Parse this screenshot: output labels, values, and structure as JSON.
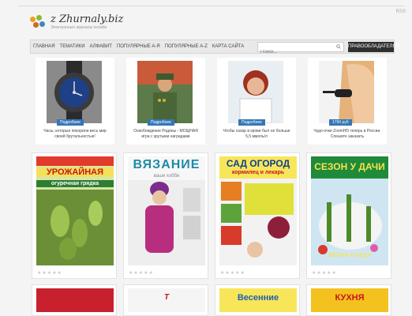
{
  "header": {
    "logo_title": "z Zhurnaly.biz",
    "logo_sub": "Электронные журналы онлайн",
    "corner_text": "RSS"
  },
  "nav": {
    "items": [
      "ГЛАВНАЯ",
      "ТЕМАТИКИ",
      "АЛФАВИТ",
      "ПОПУЛЯРНЫЕ А-Я",
      "ПОПУЛЯРНЫЕ А-Z",
      "КАРТА САЙТА"
    ],
    "search_placeholder": "Поиск...",
    "button_label": "ПРАВООБЛАДАТЕЛЯМ"
  },
  "promos": [
    {
      "tag": "Подробнее",
      "caption": "Часы, которые покорили весь мир своей брутальностью!"
    },
    {
      "tag": "Подробнее",
      "caption": "Освобождение Родины - МОЩНАЯ игра с крутыми наградами"
    },
    {
      "tag": "Подробнее",
      "caption": "Чтобы сахар в крови был не больше 5,5 ммоль/л"
    },
    {
      "tag": "1790 руб",
      "caption": "Чудо-очки ZoomHD теперь в России. Спешите заказать"
    }
  ],
  "magazines": [
    {
      "title": "УРОЖАЙНАЯ",
      "subtitle": "огуречная грядка",
      "rating": "★★★★★"
    },
    {
      "title": "ВЯЗАНИЕ",
      "subtitle": "ваше хобби",
      "rating": "★★★★★"
    },
    {
      "title": "САД ОГОРОД",
      "subtitle": "кормилец и лекарь",
      "rating": "★★★★★"
    },
    {
      "title": "СЕЗОН У ДАЧИ",
      "subtitle": "ВЕСНА В САДУ",
      "rating": "★★★★★"
    }
  ],
  "row3": [
    {
      "title": ""
    },
    {
      "title": ""
    },
    {
      "title": "Весенние"
    },
    {
      "title": "КУХНЯ"
    }
  ],
  "colors": {
    "nav_button": "#2f2f2f",
    "promo_tag": "#3576b8",
    "page_bg": "#f4f4f4"
  }
}
